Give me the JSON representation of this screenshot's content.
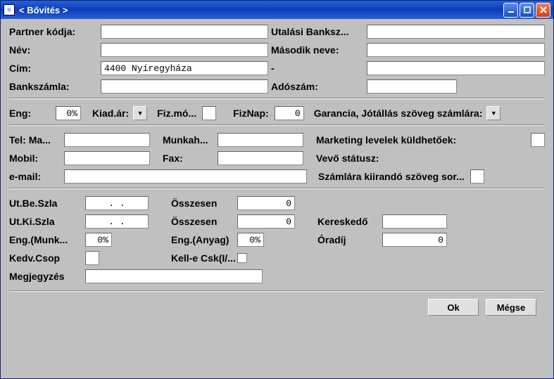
{
  "window": {
    "title": "< Bővités  >"
  },
  "labels": {
    "partner_kod": "Partner kódja:",
    "utal_bank": "Utalási Banksz...",
    "nev": "Név:",
    "masodik_neve": "Második neve:",
    "cim": "Cím:",
    "dash": "-",
    "bankszamla": "Bankszámla:",
    "adoszam": "Adószám:",
    "eng": "Eng:",
    "kiad_ar": "Kiad.ár:",
    "fiz_mo": "Fiz.mó...",
    "fiznap": "FizNap:",
    "garancia": "Garancia, Jótállás szöveg számlára:",
    "tel_ma": "Tel: Ma...",
    "munkah": "Munkah...",
    "marketing": "Marketing levelek küldhetőek:",
    "mobil": "Mobil:",
    "fax": "Fax:",
    "vevo_statusz": "Vevő státusz:",
    "email": "e-mail:",
    "szamlara": "Számlára kiirandó szöveg sor...",
    "ut_be": "Ut.Be.Szla",
    "ut_ki": "Ut.Ki.Szla",
    "osszesen": "Összesen",
    "kereskedo": "Kereskedő",
    "eng_munk": "Eng.(Munk...",
    "eng_anyag": "Eng.(Anyag)",
    "oradij": "Óradíj",
    "kedv_csop": "Kedv.Csop",
    "kelle_csk": "Kell-e Csk(I/...",
    "megjegyzes": "Megjegyzés"
  },
  "values": {
    "cim": "4400 Nyíregyháza",
    "eng_pct": "0%",
    "fiznap": "0",
    "ut_be_date": ".  .",
    "ut_ki_date": ".  .",
    "osszesen1": "0",
    "osszesen2": "0",
    "eng_munk": "0%",
    "eng_anyag": "0%",
    "oradij": "0"
  },
  "buttons": {
    "ok": "Ok",
    "megse": "Mégse"
  }
}
